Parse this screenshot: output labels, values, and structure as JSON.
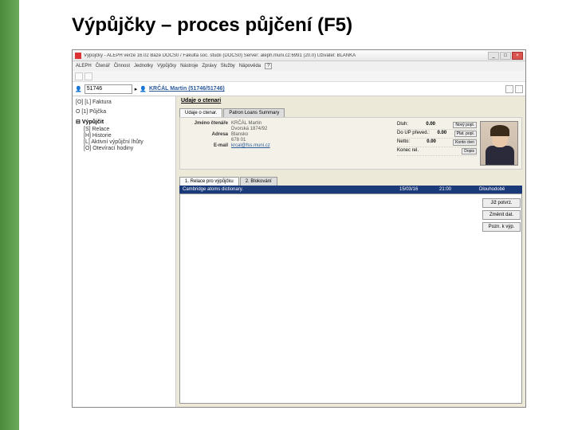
{
  "slide": {
    "title": "Výpůjčky – proces půjčení (F5)"
  },
  "window": {
    "title": "Výpůjčky - ALEPH verze 16.02 Báze DOCS0 / Fakulta soc. studií (DOCS0) Server: aleph.muni.cz:6991 (20.0) Uživatel: BLANKA"
  },
  "menu": {
    "items": [
      "ALEPH",
      "Čtenář",
      "Činnost",
      "Jednotky",
      "Výpůjčky",
      "Nástroje",
      "Zprávy",
      "Služby",
      "Nápověda"
    ]
  },
  "idbar": {
    "id": "51746",
    "patron_label": "KRČÁL Martin (51746/51746)"
  },
  "tree": {
    "top1": "[O] [L] Faktura",
    "top2": "O [1] Půjčka",
    "root": "Výpůjčit",
    "items": [
      "[S] Relace",
      "[H] Historie",
      "[L] Aktivní výpůjční lhůty",
      "[O] Otevírací hodiny"
    ]
  },
  "info": {
    "header": "Udaje o ctenari",
    "tab1": "Udaje o ctenar.",
    "tab2": "Patron Loans Summary",
    "fields": {
      "name_label": "Jméno čtenáře",
      "name_value": "KRČÁL Martin",
      "addr_label": "Adresa",
      "addr1": "Dvorská 1874/92",
      "addr2": "Blansko",
      "addr3": "678 01",
      "email_label": "E-mail",
      "email_value": "krcal@fss.muni.cz"
    },
    "balances": {
      "dluh_label": "Dluh:",
      "dluh_val": "0.00",
      "dluh_btn": "Nový popl.",
      "doup_label": "Do UP převed.:",
      "doup_val": "0.00",
      "doup_btn": "Plat. popl.",
      "netto_label": "Netto:",
      "netto_val": "0.00",
      "netto_btn": "Konto cten",
      "konec_label": "Konec rel.",
      "konec_btn": "Dopis"
    }
  },
  "subtabs": {
    "tab1": "1. Relace pro výpůjčku",
    "tab2": "2. Blokování"
  },
  "loanrow": {
    "c1": "Cambridge atoms dictionary.",
    "c2": "15/03/16",
    "c3": "21:00",
    "c4": "Dlouhodobě"
  },
  "sidebtns": {
    "b1": "Již potvrz.",
    "b2": "Změnit dat.",
    "b3": "Pozn. k výp."
  }
}
